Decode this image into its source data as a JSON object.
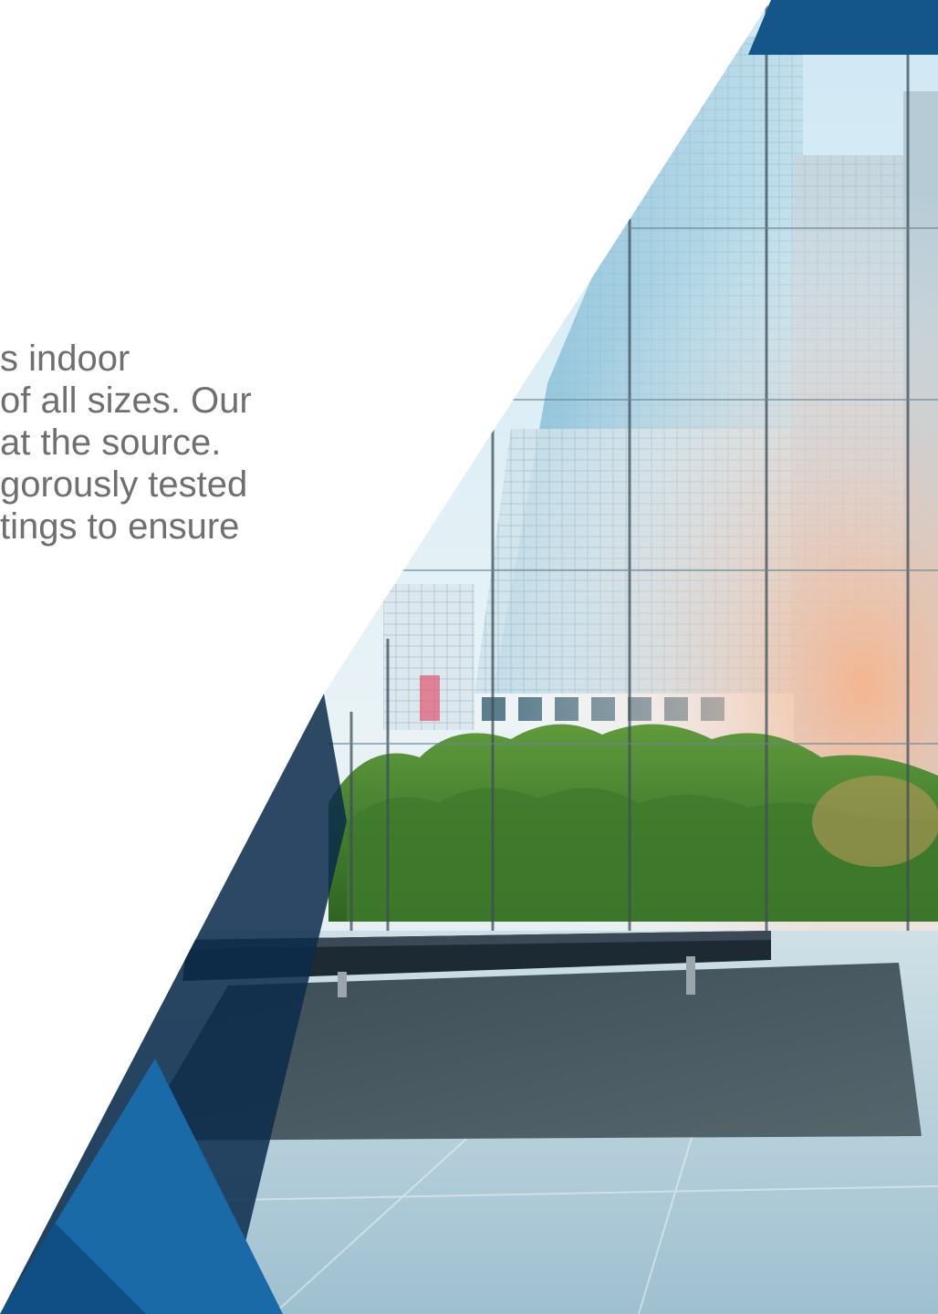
{
  "body_text": {
    "lines": [
      "s indoor",
      "of all sizes. Our",
      " at the source.",
      "gorously tested",
      "tings to ensure"
    ]
  },
  "colors": {
    "accent_blue": "#1b6aa8",
    "dark_navy": "#0b2a4a",
    "text_gray": "#6f6f6f",
    "sky": "#cfe8f5"
  },
  "image": {
    "subject": "lobby-with-glass-curtain-wall-and-city-view-photo"
  }
}
